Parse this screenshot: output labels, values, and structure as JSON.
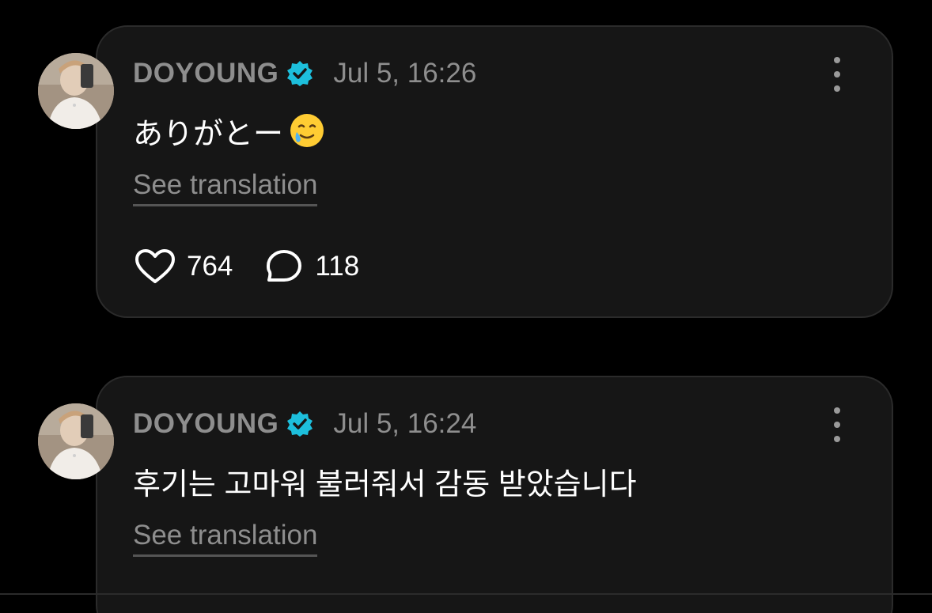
{
  "posts": [
    {
      "username": "DOYOUNG",
      "timestamp": "Jul 5, 16:26",
      "text": "ありがとー",
      "emoji": "smiling-face-with-tear-icon",
      "see_translation": "See translation",
      "likes": "764",
      "replies": "118"
    },
    {
      "username": "DOYOUNG",
      "timestamp": "Jul 5, 16:24",
      "text": "후기는 고마워 불러줘서 감동 받았습니다",
      "see_translation": "See translation"
    }
  ],
  "colors": {
    "background": "#000000",
    "card": "#161616",
    "card_border": "#2b2b2b",
    "muted_text": "#8e8e8e",
    "verified_badge": "#1dbfdc",
    "primary_text": "#ffffff"
  }
}
